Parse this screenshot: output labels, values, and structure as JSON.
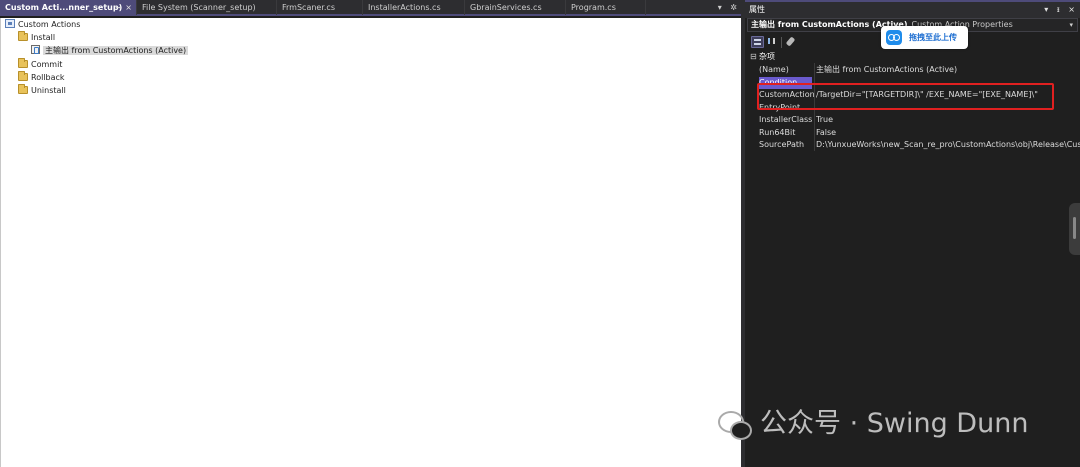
{
  "doc_tabs": [
    {
      "label": "Custom Acti...nner_setup)",
      "active": true
    },
    {
      "label": "File System (Scanner_setup)",
      "active": false
    },
    {
      "label": "FrmScaner.cs",
      "active": false
    },
    {
      "label": "InstallerActions.cs",
      "active": false
    },
    {
      "label": "GbrainServices.cs",
      "active": false
    },
    {
      "label": "Program.cs",
      "active": false
    }
  ],
  "doc_tab_glyphs": {
    "pin": "⊸",
    "close": "×",
    "overflow": "▾",
    "settings": "✲"
  },
  "tree": {
    "root": "Custom Actions",
    "nodes": [
      {
        "label": "Install",
        "icon": "folder-icon"
      },
      {
        "label": "主输出 from CustomActions (Active)",
        "icon": "custom-action-icon"
      },
      {
        "label": "Commit",
        "icon": "folder-icon"
      },
      {
        "label": "Rollback",
        "icon": "folder-icon"
      },
      {
        "label": "Uninstall",
        "icon": "folder-icon"
      }
    ]
  },
  "properties_panel": {
    "title": "属性",
    "title_controls": {
      "dropdown": "▾",
      "pin": "ᵻ",
      "close": "×"
    },
    "selector": {
      "name": "主输出 from CustomActions (Active)",
      "type": "Custom Action Properties",
      "dropdown": "▾"
    },
    "category": {
      "label": "杂项",
      "expander": "⊟"
    },
    "rows": [
      {
        "name": "(Name)",
        "value": "主输出 from CustomActions (Active)"
      },
      {
        "name": "Condition",
        "value": ""
      },
      {
        "name": "CustomActionData",
        "value": "/TargetDir=\"[TARGETDIR]\\\" /EXE_NAME=\"[EXE_NAME]\\\""
      },
      {
        "name": "EntryPoint",
        "value": ""
      },
      {
        "name": "InstallerClass",
        "value": "True"
      },
      {
        "name": "Run64Bit",
        "value": "False"
      },
      {
        "name": "SourcePath",
        "value": "D:\\YunxueWorks\\new_Scan_re_pro\\CustomActions\\obj\\Release\\CustomActions.dll"
      }
    ],
    "selected_row": "Condition"
  },
  "upload_badge": {
    "label": "拖拽至此上传"
  },
  "watermark": {
    "text": "公众号 · Swing Dunn"
  },
  "colors": {
    "accent": "#4e4b7a",
    "selection": "#6a5acd",
    "highlight_box": "#e02020",
    "badge_blue": "#1f8ceb"
  }
}
